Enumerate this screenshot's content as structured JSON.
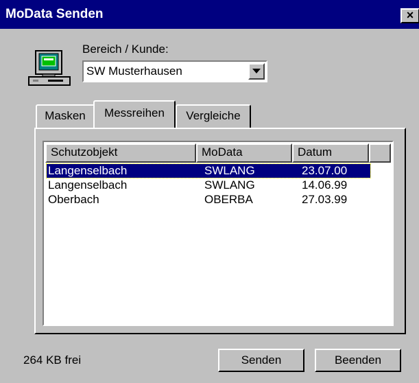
{
  "window": {
    "title": "MoData Senden",
    "close_glyph": "×"
  },
  "bereich": {
    "label": "Bereich / Kunde:",
    "selected": "SW Musterhausen"
  },
  "tabs": [
    {
      "label": "Masken"
    },
    {
      "label": "Messreihen"
    },
    {
      "label": "Vergleiche"
    }
  ],
  "list": {
    "columns": [
      "Schutzobjekt",
      "MoData",
      "Datum"
    ],
    "rows": [
      {
        "schutzobjekt": "Langenselbach",
        "modata": "SWLANG",
        "datum": "23.07.00",
        "selected": true
      },
      {
        "schutzobjekt": "Langenselbach",
        "modata": "SWLANG",
        "datum": "14.06.99",
        "selected": false
      },
      {
        "schutzobjekt": "Oberbach",
        "modata": "OBERBA",
        "datum": "27.03.99",
        "selected": false
      }
    ]
  },
  "status": {
    "free_space": "264 KB frei"
  },
  "buttons": {
    "send": "Senden",
    "quit": "Beenden"
  },
  "colors": {
    "titlebar": "#000080",
    "face": "#c0c0c0",
    "selection": "#000080"
  }
}
